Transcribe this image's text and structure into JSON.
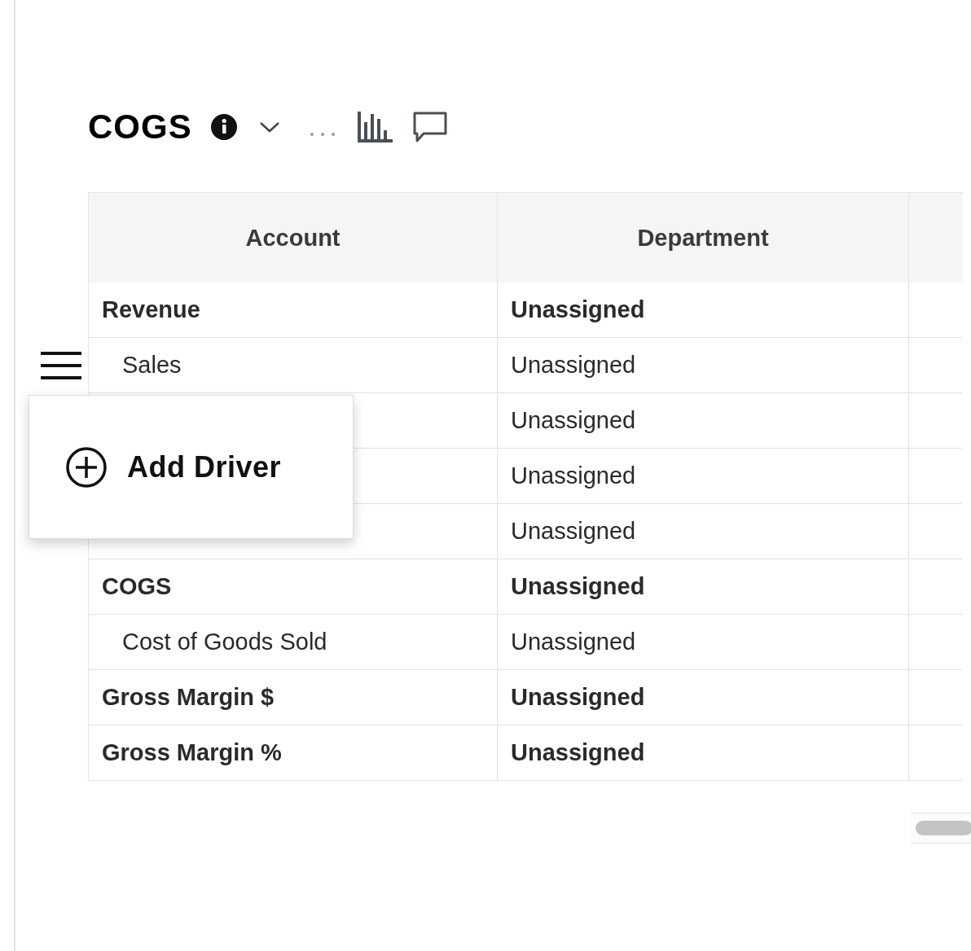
{
  "title": "COGS",
  "table": {
    "columns": [
      "Account",
      "Department"
    ],
    "rows": [
      {
        "kind": "group",
        "account": "Revenue",
        "department": "Unassigned"
      },
      {
        "kind": "child",
        "account": "Sales",
        "department": "Unassigned",
        "menu_handle": true
      },
      {
        "kind": "child",
        "department": "Unassigned"
      },
      {
        "kind": "child",
        "department": "Unassigned"
      },
      {
        "kind": "child",
        "department": "Unassigned"
      },
      {
        "kind": "group",
        "account": "COGS",
        "department": "Unassigned"
      },
      {
        "kind": "child",
        "account": "Cost of Goods Sold",
        "department": "Unassigned"
      },
      {
        "kind": "group",
        "account": "Gross Margin $",
        "department": "Unassigned"
      },
      {
        "kind": "group",
        "account": "Gross Margin %",
        "department": "Unassigned"
      }
    ]
  },
  "row_menu": {
    "items": [
      {
        "label": "Add Driver"
      }
    ]
  }
}
